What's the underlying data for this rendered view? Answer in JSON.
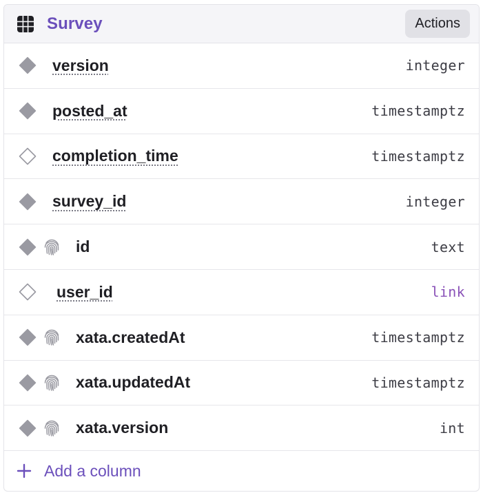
{
  "header": {
    "icon": "table-grid-icon",
    "title": "Survey",
    "actions_label": "Actions"
  },
  "columns": [
    {
      "name": "version",
      "type": "integer",
      "required": true,
      "system": false
    },
    {
      "name": "posted_at",
      "type": "timestamptz",
      "required": true,
      "system": false
    },
    {
      "name": "completion_time",
      "type": "timestamptz",
      "required": false,
      "system": false
    },
    {
      "name": "survey_id",
      "type": "integer",
      "required": true,
      "system": false
    },
    {
      "name": "id",
      "type": "text",
      "required": true,
      "system": true
    },
    {
      "name": "user_id",
      "type": "link",
      "required": false,
      "system": false
    },
    {
      "name": "xata.createdAt",
      "type": "timestamptz",
      "required": true,
      "system": true
    },
    {
      "name": "xata.updatedAt",
      "type": "timestamptz",
      "required": true,
      "system": true
    },
    {
      "name": "xata.version",
      "type": "int",
      "required": true,
      "system": true
    }
  ],
  "add_column": {
    "icon": "plus-icon",
    "label": "Add a column"
  },
  "colors": {
    "accent": "#6b4fbb",
    "link_type": "#8a52b8",
    "icon_gray": "#9a9aa2"
  }
}
